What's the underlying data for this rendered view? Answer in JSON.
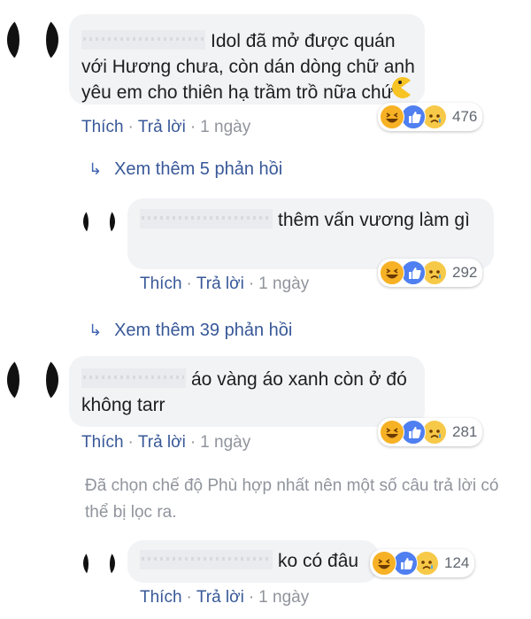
{
  "colors": {
    "link": "#385898",
    "muted": "#90949c",
    "bubble": "#f2f3f5",
    "like_blue": "#4f7ff0",
    "haha_yellow": "#f7b125"
  },
  "comments": [
    {
      "text": "Idol đã mở được quán với Hương chưa, còn dán dòng chữ anh yêu em cho thiên hạ trầm trồ nữa chứ",
      "emoji": "pacman-emoticon",
      "actions": {
        "like": "Thích",
        "reply": "Trả lời",
        "time": "1 ngày"
      },
      "reaction_count": "476",
      "view_more": "Xem thêm 5 phản hồi",
      "replies": [
        {
          "text": "thêm vấn vương làm gì",
          "actions": {
            "like": "Thích",
            "reply": "Trả lời",
            "time": "1 ngày"
          },
          "reaction_count": "292"
        }
      ],
      "view_more_after": "Xem thêm 39 phản hồi"
    },
    {
      "text": "áo vàng áo xanh còn ở đó không tarr",
      "actions": {
        "like": "Thích",
        "reply": "Trả lời",
        "time": "1 ngày"
      },
      "reaction_count": "281",
      "filter_notice": "Đã chọn chế độ Phù hợp nhất nên một số câu trả lời có thể bị lọc ra.",
      "replies": [
        {
          "text": "ko có đâu",
          "actions": {
            "like": "Thích",
            "reply": "Trả lời",
            "time": "1 ngày"
          },
          "reaction_count": "124"
        }
      ]
    }
  ],
  "icons": {
    "reactions": [
      "haha-icon",
      "like-icon",
      "sad-icon"
    ],
    "reply_arrow": "reply-arrow-icon"
  }
}
